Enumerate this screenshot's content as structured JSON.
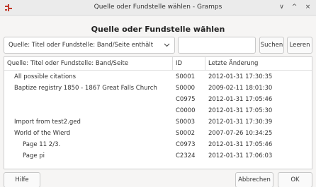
{
  "window": {
    "title": "Quelle oder Fundstelle wählen - Gramps",
    "controls": [
      "∨",
      "^",
      "×"
    ]
  },
  "dialog": {
    "heading": "Quelle oder Fundstelle wählen"
  },
  "filter": {
    "selected": "Quelle: Titel oder Fundstelle: Band/Seite enthält",
    "search_value": "",
    "search_label": "Suchen",
    "clear_label": "Leeren"
  },
  "table": {
    "columns": [
      "Quelle: Titel oder Fundstelle: Band/Seite",
      "ID",
      "Letzte Änderung"
    ],
    "rows": [
      {
        "title": "All possible citations",
        "id": "S0001",
        "changed": "2012-01-31 17:30:35",
        "indent": 1
      },
      {
        "title": "Baptize registry 1850 - 1867 Great Falls Church",
        "id": "S0000",
        "changed": "2009-02-11 18:01:30",
        "indent": 1
      },
      {
        "title": "",
        "id": "C0975",
        "changed": "2012-01-31 17:05:46",
        "indent": 2
      },
      {
        "title": "",
        "id": "C0000",
        "changed": "2012-01-31 17:05:30",
        "indent": 2
      },
      {
        "title": "Import from test2.ged",
        "id": "S0003",
        "changed": "2012-01-31 17:30:39",
        "indent": 1
      },
      {
        "title": "World of the Wierd",
        "id": "S0002",
        "changed": "2007-07-26 10:34:25",
        "indent": 1
      },
      {
        "title": "Page 11 2/3.",
        "id": "C0973",
        "changed": "2012-01-31 17:05:46",
        "indent": 2
      },
      {
        "title": "Page pi",
        "id": "C2324",
        "changed": "2012-01-31 17:06:03",
        "indent": 2
      }
    ]
  },
  "footer": {
    "help_label": "Hilfe",
    "cancel_label": "Abbrechen",
    "ok_label": "OK"
  },
  "colors": {
    "window_bg": "#f6f5f4",
    "titlebar_bg": "#ebebeb",
    "icon_red": "#c0392b"
  }
}
